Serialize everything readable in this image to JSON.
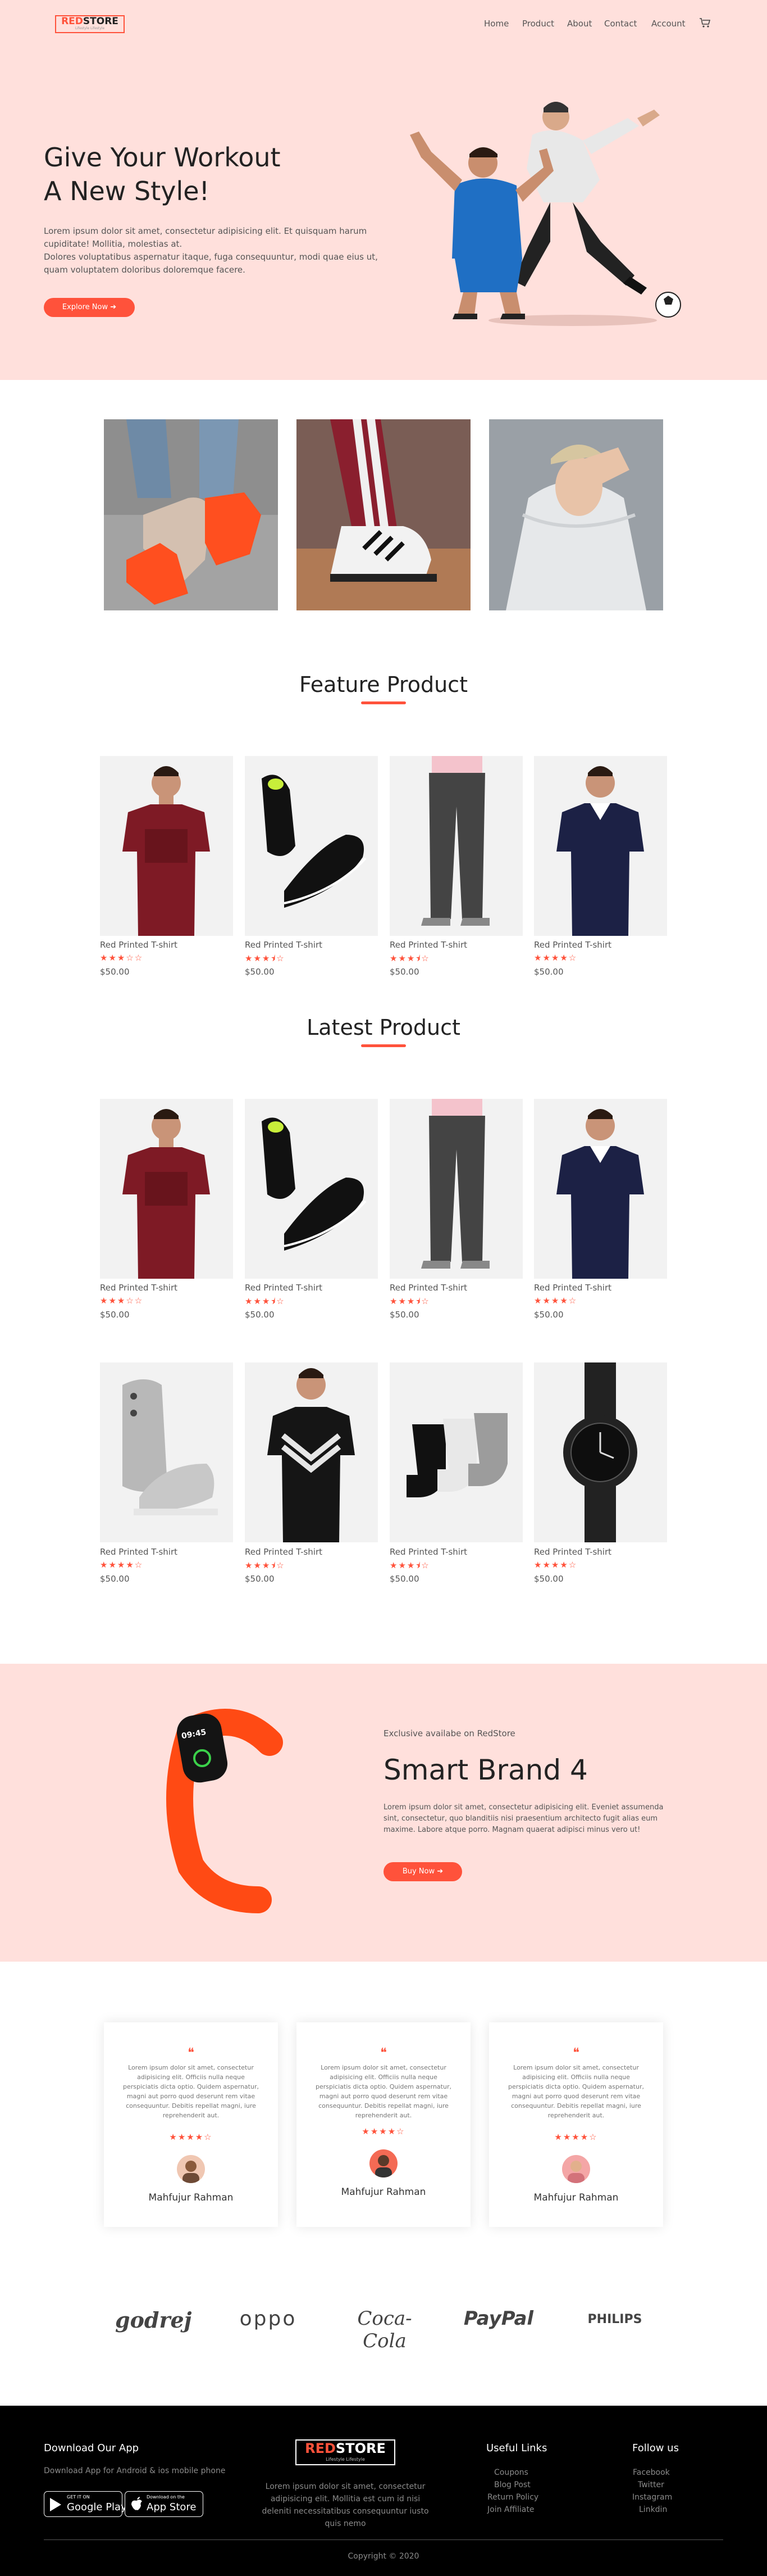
{
  "header": {
    "logo_red": "RED",
    "logo_black": "STORE",
    "logo_tagline": "Lifestyle Lifestyle",
    "nav": [
      "Home",
      "Product",
      "About",
      "Contact",
      "Account"
    ],
    "cart_icon": "cart-icon"
  },
  "hero": {
    "title": "Give Your Workout\nA New Style!",
    "text": "Lorem ipsum dolor sit amet, consectetur adipisicing elit. Et quisquam harum cupiditate! Mollitia, molestias at.\nDolores voluptatibus aspernatur itaque, fuga consequuntur, modi quae eius ut, quam voluptatem doloribus doloremque facere.",
    "button": "Explore Now ➔"
  },
  "featured": {
    "title": "Feature Product",
    "products": [
      {
        "name": "Red Printed T-shirt",
        "rating": 3,
        "stars": "★★★☆☆",
        "price": "$50.00"
      },
      {
        "name": "Red Printed T-shirt",
        "rating": 3.5,
        "stars": "★★★⯨☆",
        "price": "$50.00"
      },
      {
        "name": "Red Printed T-shirt",
        "rating": 3.5,
        "stars": "★★★⯨☆",
        "price": "$50.00"
      },
      {
        "name": "Red Printed T-shirt",
        "rating": 4,
        "stars": "★★★★☆",
        "price": "$50.00"
      }
    ]
  },
  "latest": {
    "title": "Latest Product",
    "products": [
      {
        "name": "Red Printed T-shirt",
        "rating": 3,
        "stars": "★★★☆☆",
        "price": "$50.00"
      },
      {
        "name": "Red Printed T-shirt",
        "rating": 3.5,
        "stars": "★★★⯨☆",
        "price": "$50.00"
      },
      {
        "name": "Red Printed T-shirt",
        "rating": 3.5,
        "stars": "★★★⯨☆",
        "price": "$50.00"
      },
      {
        "name": "Red Printed T-shirt",
        "rating": 4,
        "stars": "★★★★☆",
        "price": "$50.00"
      },
      {
        "name": "Red Printed T-shirt",
        "rating": 4,
        "stars": "★★★★☆",
        "price": "$50.00"
      },
      {
        "name": "Red Printed T-shirt",
        "rating": 3.5,
        "stars": "★★★⯨☆",
        "price": "$50.00"
      },
      {
        "name": "Red Printed T-shirt",
        "rating": 3.5,
        "stars": "★★★⯨☆",
        "price": "$50.00"
      },
      {
        "name": "Red Printed T-shirt",
        "rating": 4,
        "stars": "★★★★☆",
        "price": "$50.00"
      }
    ]
  },
  "offer": {
    "small": "Exclusive availabe on RedStore",
    "title": "Smart Brand 4",
    "text": "Lorem ipsum dolor sit amet, consectetur adipisicing elit. Eveniet assumenda sint, consectetur, quo blanditiis nisi praesentium architecto fugit alias eum maxime. Labore atque porro. Magnam quaerat adipisci minus vero ut!",
    "button": "Buy Now ➔",
    "band_time": "09:45"
  },
  "testimonials": [
    {
      "quote_mark": "❝",
      "text": "Lorem ipsum dolor sit amet, consectetur adipisicing elit. Officiis nulla neque perspiciatis dicta optio. Quidem aspernatur, magni aut porro quod deserunt rem vitae consequuntur. Debitis repellat magni, iure reprehenderit aut.",
      "stars": "★★★★☆",
      "rating": 4,
      "name": "Mahfujur Rahman"
    },
    {
      "quote_mark": "❝",
      "text": "Lorem ipsum dolor sit amet, consectetur adipisicing elit. Officiis nulla neque perspiciatis dicta optio. Quidem aspernatur, magni aut porro quod deserunt rem vitae consequuntur. Debitis repellat magni, iure reprehenderit aut.",
      "stars": "★★★★☆",
      "rating": 4,
      "name": "Mahfujur Rahman"
    },
    {
      "quote_mark": "❝",
      "text": "Lorem ipsum dolor sit amet, consectetur adipisicing elit. Officiis nulla neque perspiciatis dicta optio. Quidem aspernatur, magni aut porro quod deserunt rem vitae consequuntur. Debitis repellat magni, iure reprehenderit aut.",
      "stars": "★★★★☆",
      "rating": 4,
      "name": "Mahfujur Rahman"
    }
  ],
  "brands": [
    "godrej",
    "oppo",
    "Coca-Cola",
    "PayPal",
    "PHILIPS"
  ],
  "footer": {
    "download_title": "Download Our App",
    "download_text": "Download App for Android & ios mobile phone",
    "google_small": "GET IT ON",
    "google_big": "Google Play",
    "apple_small": "Download on the",
    "apple_big": "App Store",
    "logo_red": "RED",
    "logo_white": "STORE",
    "logo_tagline": "Lifestyle Lifestyle",
    "about_text": "Lorem ipsum dolor sit amet, consectetur adipisicing elit. Mollitia est cum id nisi deleniti necessitatibus consequuntur iusto quis nemo",
    "useful_title": "Useful Links",
    "useful_links": [
      "Coupons",
      "Blog Post",
      "Return Policy",
      "Join Affiliate"
    ],
    "follow_title": "Follow us",
    "follow_links": [
      "Facebook",
      "Twitter",
      "Instagram",
      "Linkdin"
    ],
    "copyright": "Copyright © 2020"
  },
  "colors": {
    "accent": "#ff523b",
    "hero_bg": "#ffe0dc",
    "footer_bg": "#000000"
  }
}
